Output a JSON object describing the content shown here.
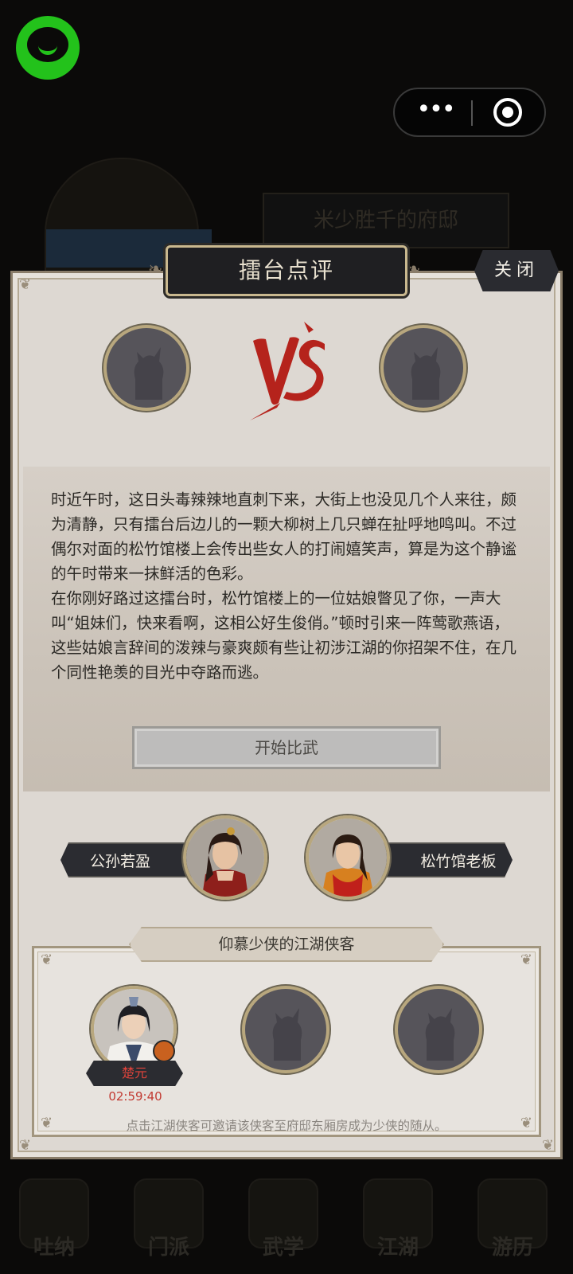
{
  "background": {
    "banner_text": "米少胜千的府邸",
    "bottom_nav": [
      {
        "label": "吐纳",
        "icon": "meditation-icon"
      },
      {
        "label": "门派",
        "icon": "sect-icon"
      },
      {
        "label": "武学",
        "icon": "martial-arts-icon"
      },
      {
        "label": "江湖",
        "icon": "jianghu-icon"
      },
      {
        "label": "游历",
        "icon": "travel-icon"
      }
    ]
  },
  "topbar": {
    "logo_icon": "green-chat-logo-icon",
    "menu_icon": "more-dots-icon",
    "dots_glyph": "•••",
    "close_icon": "target-circle-icon"
  },
  "dialog": {
    "title": "擂台点评",
    "close_label": "关闭",
    "vs_label": "VS",
    "story": [
      "时近午时，这日头毒辣辣地直刺下来，大街上也没见几个人来往，颇为清静，只有擂台后边儿的一颗大柳树上几只蝉在扯呼地鸣叫。不过偶尔对面的松竹馆楼上会传出些女人的打闹嬉笑声，算是为这个静谧的午时带来一抹鲜活的色彩。",
      "在你刚好路过这擂台时，松竹馆楼上的一位姑娘瞥见了你，一声大叫“姐妹们，快来看啊，这相公好生俊俏。”顿时引来一阵莺歌燕语，这些姑娘言辞间的泼辣与豪爽颇有些让初涉江湖的你招架不住，在几个同性艳羡的目光中夺路而逃。"
    ],
    "start_button": "开始比武",
    "left_character": "公孙若盈",
    "right_character": "松竹馆老板",
    "guest_section_title": "仰慕少侠的江湖侠客",
    "guests": [
      {
        "name": "楚元",
        "timer": "02:59:40"
      }
    ],
    "guest_hint": "点击江湖侠客可邀请该侠客至府邸东厢房成为少侠的随从。"
  },
  "colors": {
    "panel": "#ddd8d2",
    "plate_dark": "#2b2c31",
    "gold_border": "#c9b88f",
    "vs_red": "#b5231c",
    "timer_red": "#c23a32",
    "logo_green": "#23c21b"
  }
}
